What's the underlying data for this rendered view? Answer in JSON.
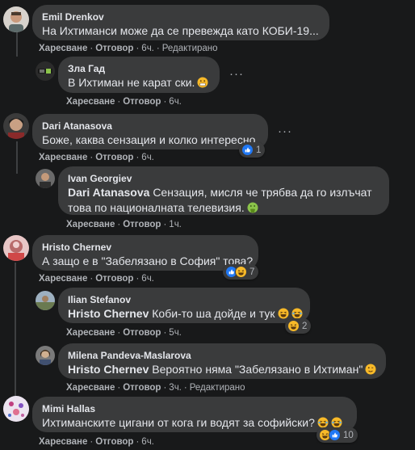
{
  "ui": {
    "like": "Харесване",
    "reply": "Отговор",
    "sep": "·",
    "edited": "Редактирано"
  },
  "comments": [
    {
      "author": "Emil Drenkov",
      "text": "На Ихтиманси може да се превежда като КОБИ-19...",
      "time": "6ч.",
      "edited": true
    },
    {
      "author": "Зла Гад",
      "text": "В Ихтиман не карат ски.",
      "time": "6ч.",
      "emoji": "grimace"
    },
    {
      "author": "Dari Atanasova",
      "text": "Боже, каква сензация и колко интересно",
      "time": "6ч.",
      "reactions": {
        "icons": [
          "like"
        ],
        "count": "1"
      }
    },
    {
      "author": "Ivan Georgiev",
      "mention": "Dari Atanasova",
      "text": "Сензация, мисля че трябва да го излъчат това по националната телевизия.",
      "time": "1ч.",
      "emoji": "vomit"
    },
    {
      "author": "Hristo Chernev",
      "text": "А защо е в \"Забелязано в София\" това?",
      "time": "6ч.",
      "reactions": {
        "icons": [
          "like",
          "haha"
        ],
        "count": "7"
      }
    },
    {
      "author": "Ilian Stefanov",
      "mention": "Hristo Chernev",
      "text": "Коби-то ша дойде и тук",
      "time": "5ч.",
      "emoji": "haha",
      "reactions": {
        "icons": [
          "haha"
        ],
        "count": "2"
      }
    },
    {
      "author": "Milena Pandeva-Maslarova",
      "mention": "Hristo Chernev",
      "text": "Вероятно няма \"Забелязано в Ихтиман\"",
      "time": "3ч.",
      "edited": true,
      "emoji": "wink"
    },
    {
      "author": "Mimi Hallas",
      "text": "Ихтиманските цигани от кога ги водят за софийски?",
      "time": "6ч.",
      "emoji": "rofl",
      "reactions": {
        "icons": [
          "haha",
          "like"
        ],
        "count": "10"
      }
    }
  ],
  "colors": {
    "background": "#18191a",
    "bubble": "#3a3b3c",
    "text": "#e4e6eb",
    "muted": "#b0b3b8",
    "like_blue": "#2078f4",
    "haha_yellow": "#f7b928"
  },
  "icons": [
    "like-icon",
    "haha-icon",
    "grimace-emoji",
    "vomit-emoji",
    "wink-emoji",
    "rofl-emoji",
    "more-options-icon"
  ]
}
